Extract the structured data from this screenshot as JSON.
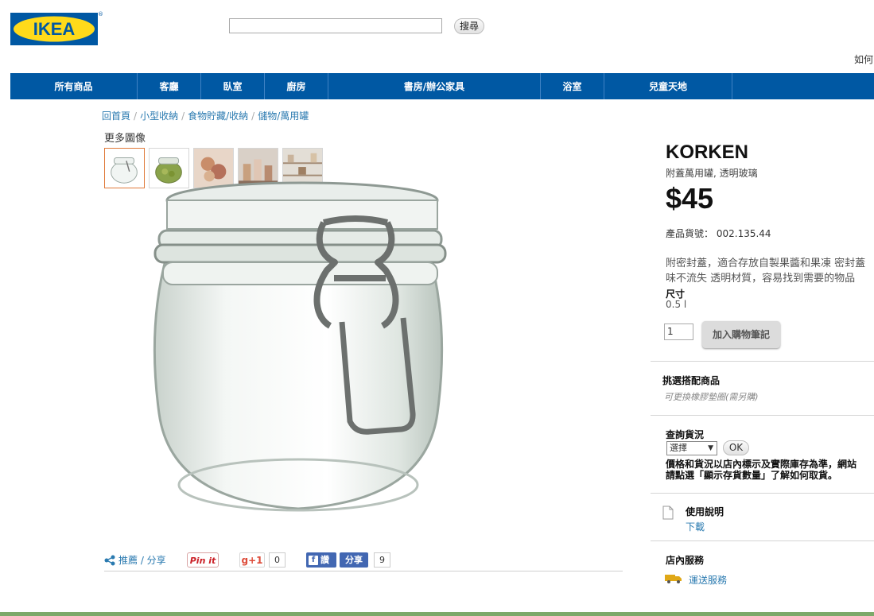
{
  "header": {
    "logo_text": "IKEA",
    "search_placeholder": "",
    "search_button": "搜尋",
    "howto": "如何"
  },
  "nav": [
    {
      "label": "所有商品"
    },
    {
      "label": "客廳"
    },
    {
      "label": "臥室"
    },
    {
      "label": "廚房"
    },
    {
      "label": "書房/辦公家具"
    },
    {
      "label": "浴室"
    },
    {
      "label": "兒童天地"
    }
  ],
  "breadcrumb": [
    "回首頁",
    "小型收納",
    "食物貯藏/收納",
    "儲物/萬用罐"
  ],
  "gallery": {
    "more_images_label": "更多圖像"
  },
  "share": {
    "recommend_label": "推薦 / 分享",
    "pinit_label": "Pin it",
    "gplus_label": "g+1",
    "gplus_count": "0",
    "fb_like_label": "讚",
    "fb_share_label": "分享",
    "fb_count": "9"
  },
  "product": {
    "name": "KORKEN",
    "subtitle": "附蓋萬用罐, 透明玻璃",
    "price": "$45",
    "article_label": "產品貨號：",
    "article_number": "002.135.44",
    "description_line1": "附密封蓋，適合存放自製果醬和果凍 密封蓋",
    "description_line2": "味不流失 透明材質，容易找到需要的物品",
    "size_label": "尺寸",
    "size_value": "0.5 l",
    "quantity": "1",
    "add_to_cart": "加入購物筆記"
  },
  "matching": {
    "title": "挑選搭配商品",
    "note": "可更換橡膠墊圈(需另購)"
  },
  "stock": {
    "title": "查詢貨況",
    "select_value": "選擇",
    "ok_label": "OK",
    "note_line1": "價格和貨況以店內標示及實際庫存為準，網站",
    "note_line2": "請點選「顯示存貨數量」了解如何取貨。"
  },
  "manual": {
    "title": "使用說明",
    "link": "下載"
  },
  "services": {
    "title": "店內服務",
    "delivery": "運送服務"
  },
  "colors": {
    "nav_blue": "#0058a3",
    "logo_yellow": "#ffda1a",
    "link_blue": "#2a7ab0"
  }
}
